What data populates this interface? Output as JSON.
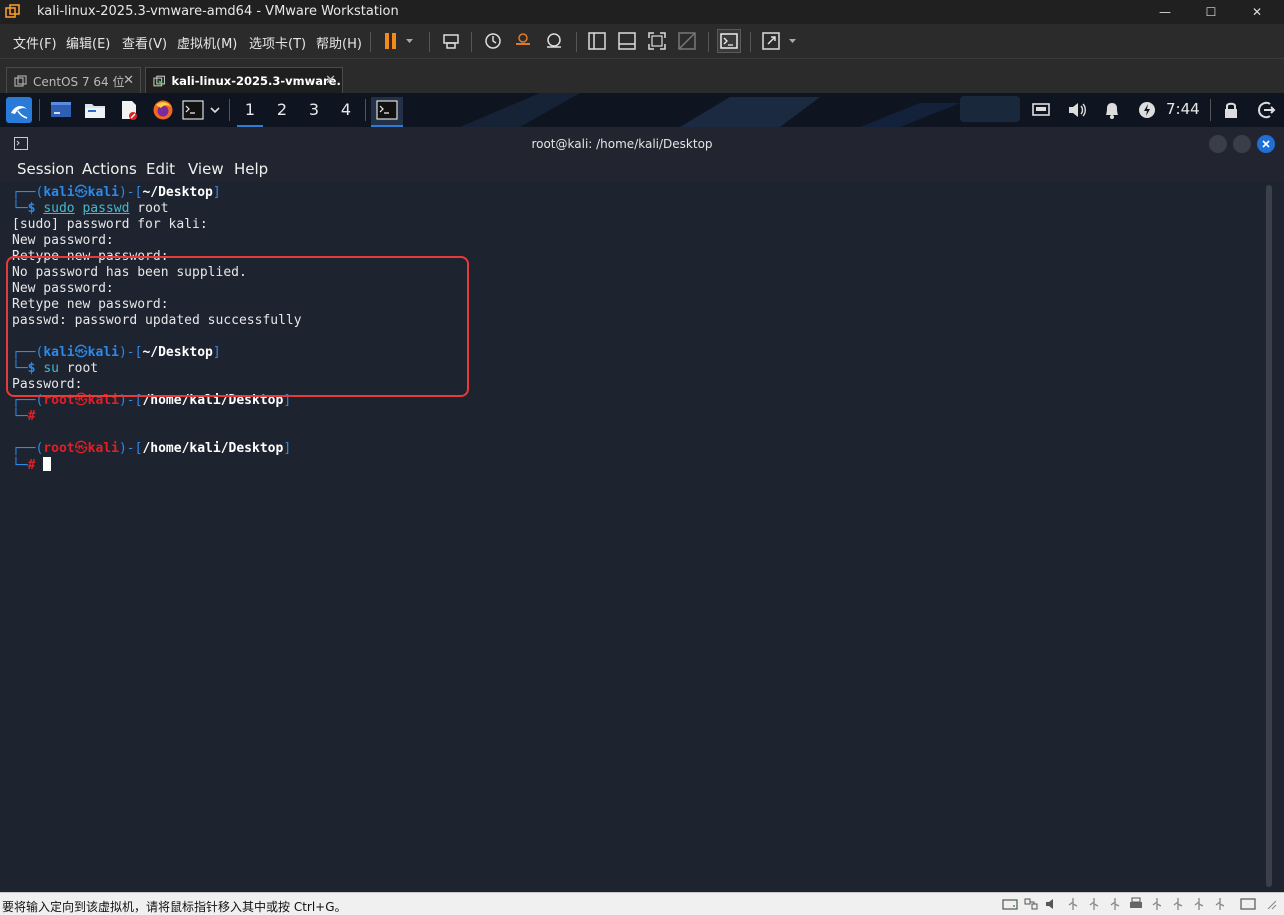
{
  "window": {
    "title": "kali-linux-2025.3-vmware-amd64 - VMware Workstation",
    "min_glyph": "—",
    "max_glyph": "☐",
    "close_glyph": "✕"
  },
  "menu": {
    "items": [
      "文件(F)",
      "编辑(E)",
      "查看(V)",
      "虚拟机(M)",
      "选项卡(T)",
      "帮助(H)"
    ]
  },
  "tabs": [
    {
      "label": "CentOS 7 64 位",
      "active": false
    },
    {
      "label": "kali-linux-2025.3-vmware...",
      "active": true
    }
  ],
  "tab_close_glyph": "✕",
  "panel": {
    "workspaces": [
      "1",
      "2",
      "3",
      "4"
    ],
    "active_workspace": "1",
    "clock": "7:44"
  },
  "terminal": {
    "title": "root@kali: /home/kali/Desktop",
    "menu": [
      "Session",
      "Actions",
      "Edit",
      "View",
      "Help"
    ],
    "prompt_glyphs": {
      "top_corner": "┌──(",
      "bottom_corner": "└─",
      "at": "㉿",
      "sep": ")-[",
      "close": "]",
      "dollar": "$",
      "hash": "#"
    },
    "user_kali": "kali",
    "host": "kali",
    "user_root": "root",
    "path_home": "~/Desktop",
    "path_full": "/home/kali/Desktop",
    "cmd1": {
      "sudo": "sudo",
      "passwd": "passwd",
      "arg": " root"
    },
    "output1": [
      "[sudo] password for kali:",
      "New password:",
      "Retype new password:",
      "No password has been supplied.",
      "New password:",
      "Retype new password:",
      "passwd: password updated successfully"
    ],
    "cmd2": {
      "su": "su",
      "arg": " root"
    },
    "output2": "Password:"
  },
  "statusbar": {
    "text": "要将输入定向到该虚拟机，请将鼠标指针移入其中或按 Ctrl+G。"
  },
  "colors": {
    "terminal_bg": "#1e2330",
    "prompt_blue": "#2d8ae8",
    "prompt_red": "#e51e25",
    "highlight_box": "#e63b3b",
    "active_accent": "#2e7cd6"
  }
}
